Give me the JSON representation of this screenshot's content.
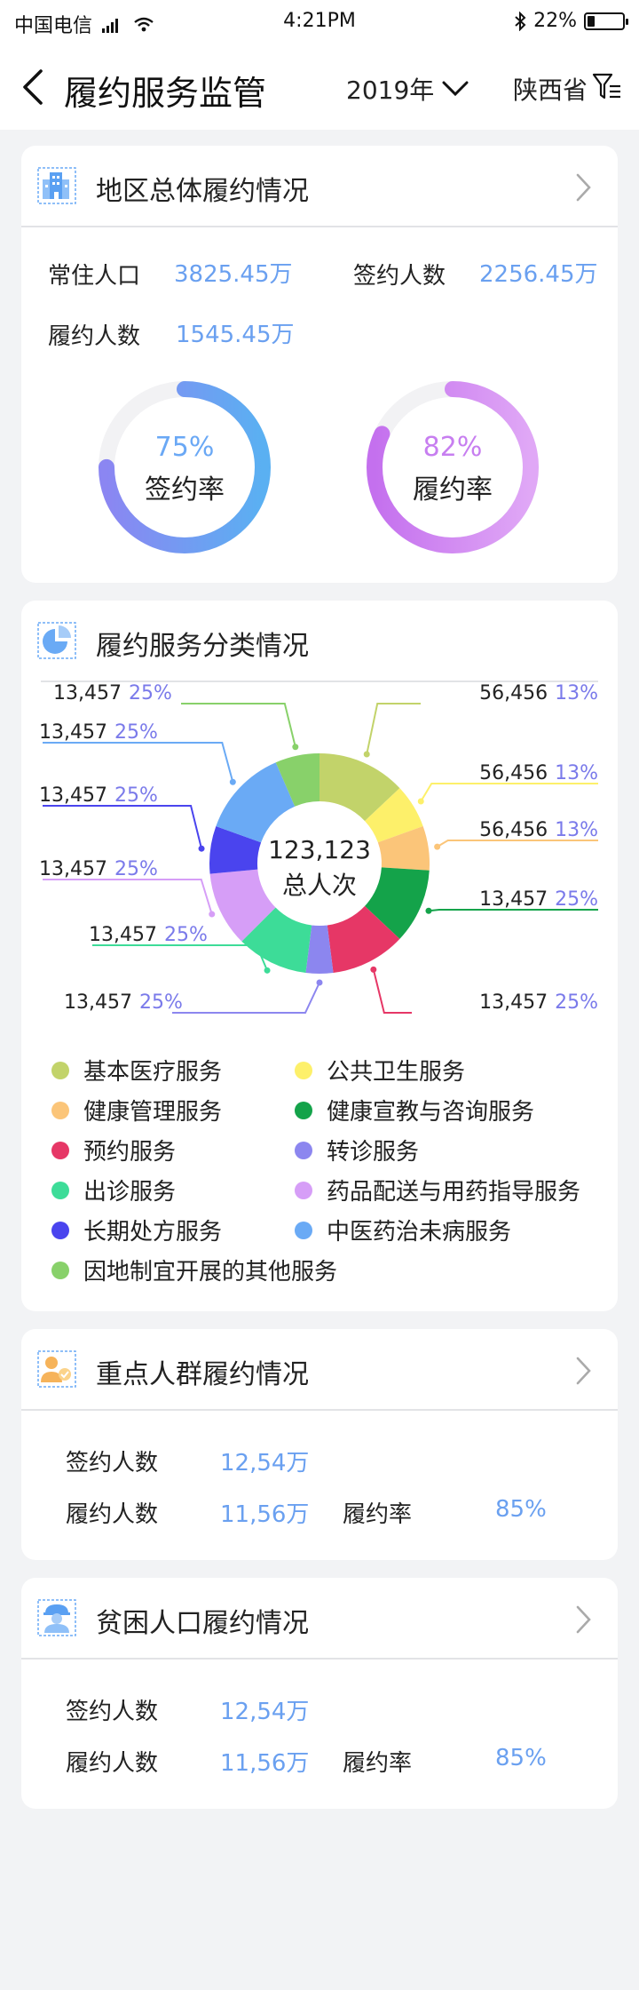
{
  "status_bar": {
    "carrier": "中国电信",
    "time": "4:21PM",
    "battery": "22%",
    "battery_level": 0.22
  },
  "nav": {
    "title": "履约服务监管",
    "year": "2019年",
    "region": "陕西省"
  },
  "overall": {
    "title": "地区总体履约情况",
    "resident_label": "常住人口",
    "resident_value": "3825.45万",
    "signed_label": "签约人数",
    "signed_value": "2256.45万",
    "performed_label": "履约人数",
    "performed_value": "1545.45万",
    "sign_rate": {
      "value": 0.75,
      "text": "75%",
      "label": "签约率",
      "color": "#6aa8f5"
    },
    "perform_rate": {
      "value": 0.82,
      "text": "82%",
      "label": "履约率",
      "color": "#c77ef0"
    }
  },
  "category": {
    "title": "履约服务分类情况",
    "center_value": "123,123",
    "center_label": "总人次",
    "slices": [
      {
        "name": "基本医疗服务",
        "value": 13,
        "color": "#c2d36a"
      },
      {
        "name": "公共卫生服务",
        "value": 6.5,
        "color": "#fdf06a"
      },
      {
        "name": "健康管理服务",
        "value": 6.5,
        "color": "#fbc579"
      },
      {
        "name": "健康宣教与咨询服务",
        "value": 11,
        "color": "#14a34a"
      },
      {
        "name": "预约服务",
        "value": 11,
        "color": "#e63766"
      },
      {
        "name": "转诊服务",
        "value": 4,
        "color": "#8c86ef"
      },
      {
        "name": "出诊服务",
        "value": 10.5,
        "color": "#3ddc98"
      },
      {
        "name": "药品配送与用药指导服务",
        "value": 11,
        "color": "#d69ef7"
      },
      {
        "name": "长期处方服务",
        "value": 7,
        "color": "#4a44ee"
      },
      {
        "name": "中医药治未病服务",
        "value": 13,
        "color": "#6aaaf5"
      },
      {
        "name": "因地制宜开展的其他服务",
        "value": 6.5,
        "color": "#88d16a"
      }
    ],
    "labels": [
      {
        "count": "13,457",
        "pct": "25%"
      },
      {
        "count": "56,456",
        "pct": "13%"
      },
      {
        "count": "13,457",
        "pct": "25%"
      },
      {
        "count": "56,456",
        "pct": "13%"
      },
      {
        "count": "13,457",
        "pct": "25%"
      },
      {
        "count": "56,456",
        "pct": "13%"
      },
      {
        "count": "13,457",
        "pct": "25%"
      },
      {
        "count": "13,457",
        "pct": "25%"
      },
      {
        "count": "13,457",
        "pct": "25%"
      },
      {
        "count": "13,457",
        "pct": "25%"
      },
      {
        "count": "13,457",
        "pct": "25%"
      }
    ]
  },
  "key_groups": {
    "title": "重点人群履约情况",
    "signed_label": "签约人数",
    "signed_value": "12,54万",
    "performed_label": "履约人数",
    "performed_value": "11,56万",
    "rate_label": "履约率",
    "rate_value": "85%"
  },
  "poverty": {
    "title": "贫困人口履约情况",
    "signed_label": "签约人数",
    "signed_value": "12,54万",
    "performed_label": "履约人数",
    "performed_value": "11,56万",
    "rate_label": "履约率",
    "rate_value": "85%"
  }
}
